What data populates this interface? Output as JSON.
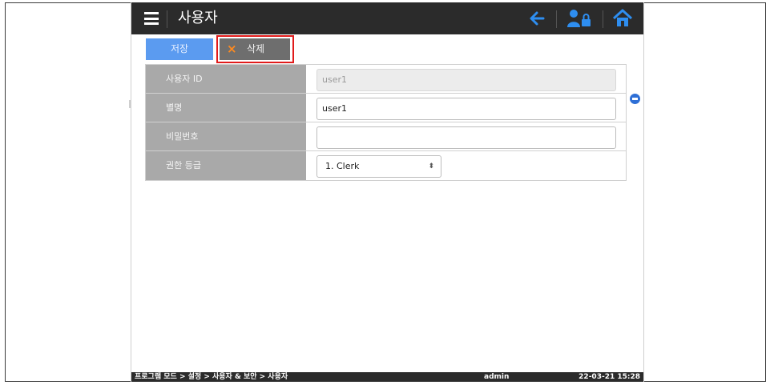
{
  "header": {
    "title": "사용자",
    "icons": {
      "menu": "hamburger-menu-icon",
      "back": "arrow-left-icon",
      "user_lock": "user-lock-icon",
      "home": "home-icon"
    }
  },
  "toolbar": {
    "save_label": "저장",
    "delete_label": "삭제",
    "delete_icon": "×"
  },
  "form": {
    "rows": [
      {
        "label": "사용자 ID",
        "value": "user1",
        "disabled": true
      },
      {
        "label": "별명",
        "value": "user1"
      },
      {
        "label": "비밀번호",
        "value": ""
      },
      {
        "label": "권한 등급",
        "value": "1. Clerk",
        "type": "select",
        "arrow": "⬍"
      }
    ]
  },
  "statusbar": {
    "breadcrumb": "프로그램 모드 > 설정 > 사용자 & 보안 > 사용자",
    "user": "admin",
    "datetime": "22-03-21 15:28"
  },
  "colors": {
    "header_bg": "#2b2b2b",
    "save_button": "#5b9bf0",
    "delete_button": "#6e6e6e",
    "highlight": "#e11b1b",
    "label_bg": "#a9a9a9",
    "accent_blue": "#2e8ef0"
  }
}
